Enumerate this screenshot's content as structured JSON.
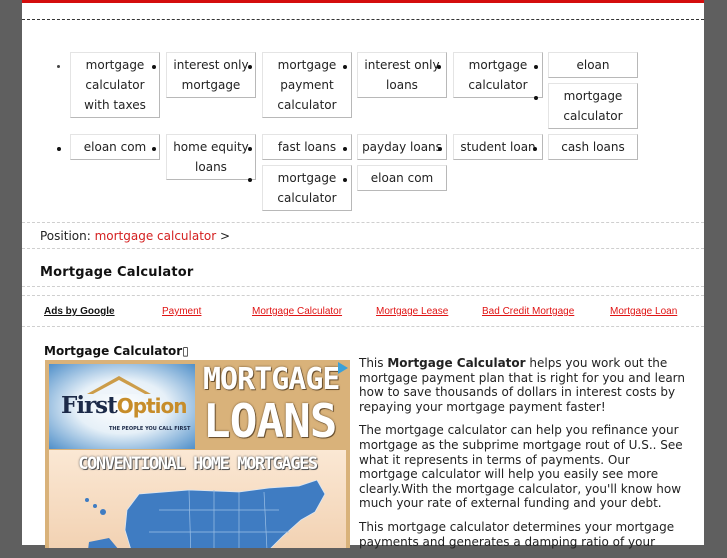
{
  "link_grid": {
    "row1": [
      {
        "label": "mortgage calculator with taxes"
      },
      {
        "label": "interest only mortgage"
      },
      {
        "label": "mortgage payment calculator"
      },
      {
        "label": "interest only loans"
      },
      {
        "label": "mortgage calculator"
      },
      {
        "label": "eloan"
      },
      {
        "label": "mortgage calculator"
      }
    ],
    "row2": [
      {
        "label": "eloan com"
      },
      {
        "label": "home equity loans"
      },
      {
        "label": "fast loans"
      },
      {
        "label": "mortgage calculator"
      },
      {
        "label": "payday loans"
      },
      {
        "label": "eloan com"
      },
      {
        "label": "student loan"
      },
      {
        "label": "cash loans"
      }
    ]
  },
  "breadcrumb": {
    "prefix": "Position:",
    "link": "mortgage calculator",
    "separator": ">"
  },
  "page_title": "Mortgage Calculator",
  "ads_bar": {
    "label": "Ads by Google",
    "links": [
      "Payment",
      "Mortgage Calculator",
      "Mortgage Lease",
      "Bad Credit Mortgage",
      "Mortgage Loan"
    ]
  },
  "section_title": "Mortgage Calculator▯",
  "ad_banner": {
    "brand_first": "First",
    "brand_second": "Option",
    "tagline": "THE PEOPLE YOU CALL FIRST",
    "headline_1": "MORTGAGE",
    "headline_2": "LOANS",
    "subheadline": "CONVENTIONAL HOME MORTGAGES",
    "ad_choice_icon": "adchoices-icon"
  },
  "article": {
    "p1_before": "This ",
    "p1_bold": "Mortgage Calculator",
    "p1_after": " helps you work out the mortgage payment plan that is right for you and learn how to save thousands of dollars in interest costs by repaying your mortgage payment faster!",
    "p2": "The mortgage calculator can help you refinance your mortgage as the subprime mortgage rout of U.S.. See what it represents in terms of payments. Our mortgage calculator will help you easily see more clearly.With the mortgage calculator, you'll know how much your rate of external funding and your debt.",
    "p3": "This mortgage calculator determines your mortgage payments and generates a damping ratio of your"
  },
  "colors": {
    "accent_red": "#d40d0d",
    "link_red": "#d42020",
    "ad_link_red": "#e01414",
    "background_gray": "#5f5f5f"
  }
}
